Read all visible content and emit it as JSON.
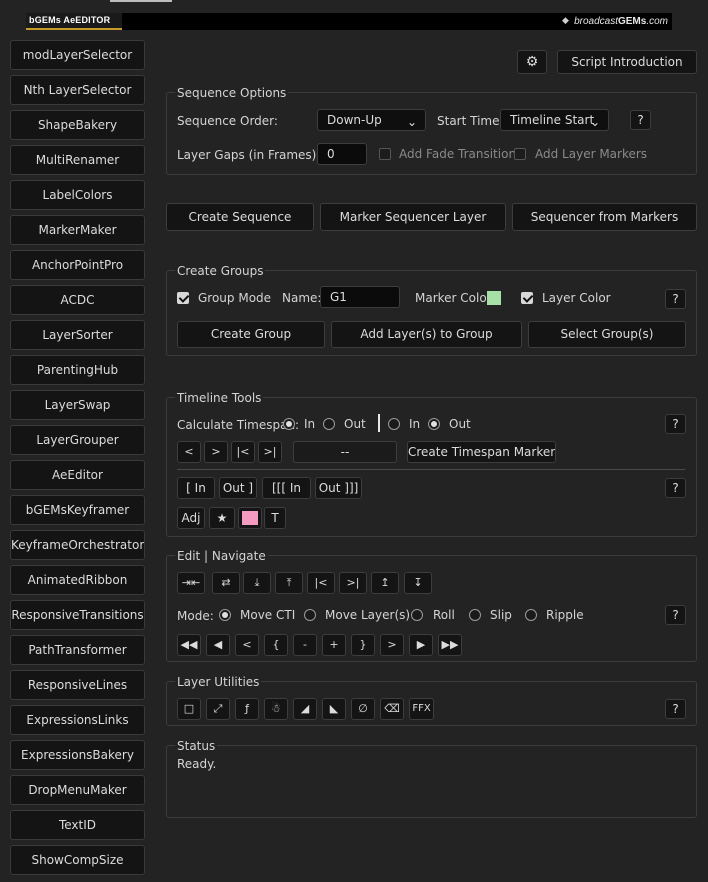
{
  "header": {
    "logo": "bGEMs AeEDITOR",
    "brand_prefix": "broadcast",
    "brand_bold": "GEMs",
    "brand_suffix": ".com"
  },
  "sidebar": {
    "items": [
      "modLayerSelector",
      "Nth LayerSelector",
      "ShapeBakery",
      "MultiRenamer",
      "LabelColors",
      "MarkerMaker",
      "AnchorPointPro",
      "ACDC",
      "LayerSorter",
      "ParentingHub",
      "LayerSwap",
      "LayerGrouper",
      "AeEditor",
      "bGEMsKeyframer",
      "KeyframeOrchestrator",
      "AnimatedRibbon",
      "ResponsiveTransitions",
      "PathTransformer",
      "ResponsiveLines",
      "ExpressionsLinks",
      "ExpressionsBakery",
      "DropMenuMaker",
      "TextID",
      "ShowCompSize"
    ]
  },
  "top": {
    "script_intro": "Script Introduction"
  },
  "sequence": {
    "title": "Sequence Options",
    "order_label": "Sequence Order:",
    "order_value": "Down-Up",
    "start_label": "Start Time:",
    "start_value": "Timeline Start",
    "help": "?",
    "gaps_label": "Layer Gaps (in Frames):",
    "gaps_value": "0",
    "fade_label": "Add Fade Transition",
    "markers_label": "Add Layer Markers"
  },
  "actions": {
    "create_sequence": "Create Sequence",
    "marker_sequencer": "Marker Sequencer Layer",
    "from_markers": "Sequencer from Markers"
  },
  "groups": {
    "title": "Create Groups",
    "mode_label": "Group Mode",
    "name_label": "Name:",
    "name_value": "G1",
    "marker_color_label": "Marker Color:",
    "marker_color": "#a6e0a6",
    "layer_color_label": "Layer Color",
    "help": "?",
    "create_group": "Create Group",
    "add_layers": "Add Layer(s) to Group",
    "select_groups": "Select Group(s)"
  },
  "timeline": {
    "title": "Timeline Tools",
    "calc_label": "Calculate Timespan:",
    "in_label": "In",
    "out_label": "Out",
    "in2_label": "In",
    "out2_label": "Out",
    "help": "?",
    "nav": [
      "<",
      ">",
      "|<",
      ">|"
    ],
    "span_value": "--",
    "create_markers": "Create Timespan Markers",
    "trim": [
      "[ In",
      "Out ]",
      "[[[ In",
      "Out ]]]"
    ],
    "help2": "?",
    "adj": "Adj",
    "star": "★",
    "swatch_color": "#f59ac0",
    "text_t": "T"
  },
  "edit": {
    "title": "Edit | Navigate",
    "tools": [
      "⇥⇤",
      "⇄",
      "⤓",
      "⤒",
      "|<",
      ">|",
      "↥",
      "↧"
    ],
    "mode_label": "Mode:",
    "modes": [
      "Move CTI",
      "Move Layer(s)",
      "Roll",
      "Slip",
      "Ripple"
    ],
    "help": "?",
    "transport": [
      "◀◀",
      "◀",
      "<",
      "{",
      "-",
      "+",
      "}",
      ">",
      "▶",
      "▶▶"
    ]
  },
  "utilities": {
    "title": "Layer Utilities",
    "tools": [
      "□",
      "⤢",
      "ƒ",
      "☃",
      "◢",
      "◣",
      "∅",
      "⌫",
      "FFX"
    ],
    "help": "?"
  },
  "status": {
    "title": "Status",
    "text": "Ready."
  }
}
